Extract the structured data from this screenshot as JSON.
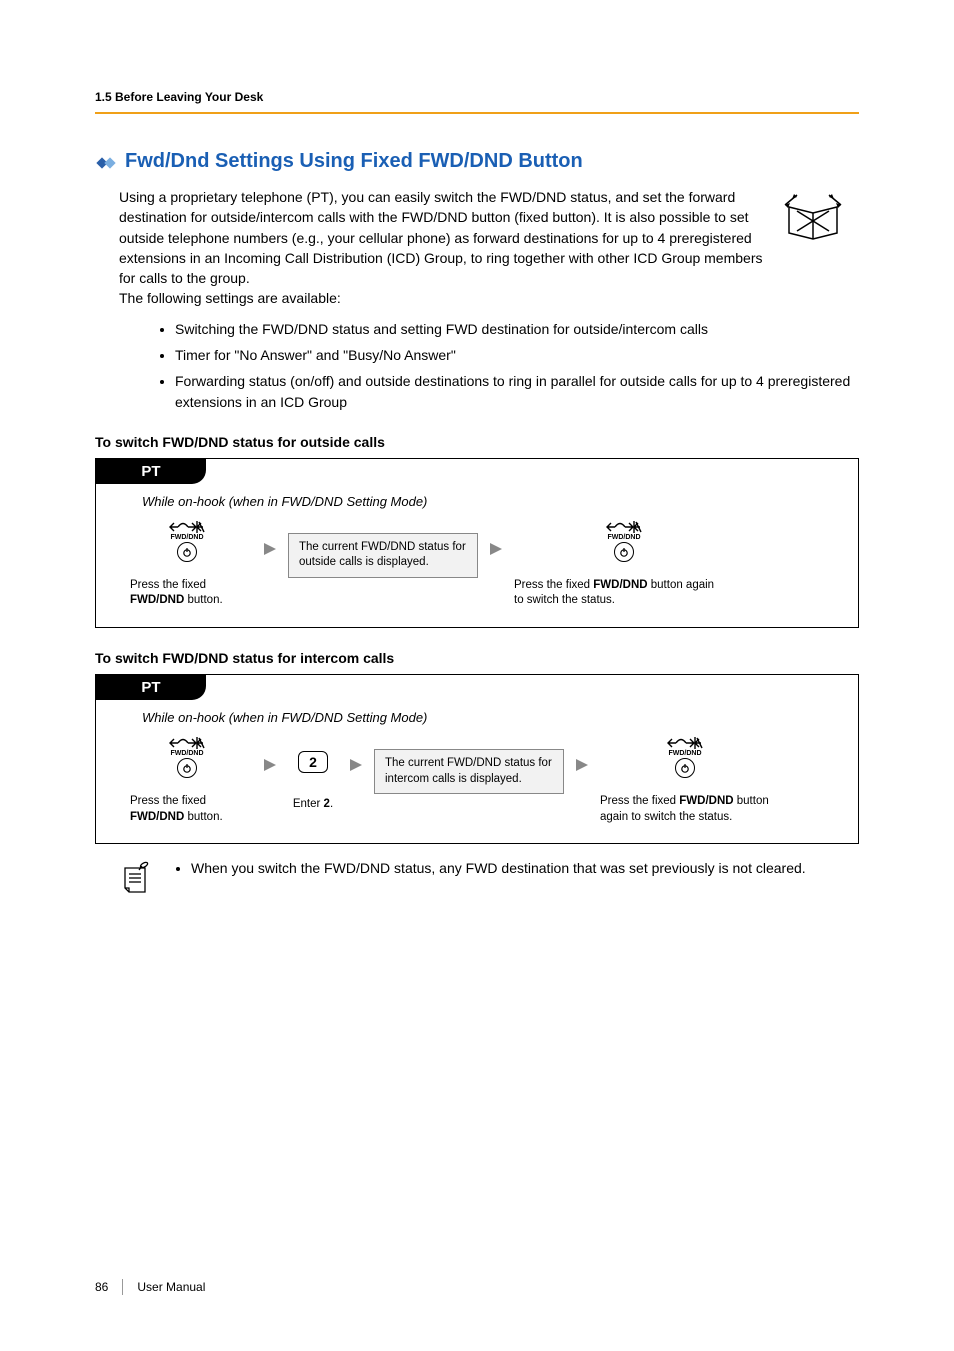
{
  "header": {
    "running": "1.5 Before Leaving Your Desk"
  },
  "section": {
    "title": "Fwd/Dnd Settings Using Fixed FWD/DND Button",
    "intro": "Using a proprietary telephone (PT), you can easily switch the FWD/DND status, and set the forward destination for outside/intercom calls with the FWD/DND button (fixed button). It is also possible to set outside telephone numbers (e.g., your cellular phone) as forward destinations for up to 4 preregistered extensions in an Incoming Call Distribution (ICD) Group, to ring together with other ICD Group members for calls to the group.\nThe following settings are available:",
    "bullets": [
      "Switching the FWD/DND status and setting FWD destination for outside/intercom calls",
      "Timer for \"No Answer\" and \"Busy/No Answer\"",
      "Forwarding status (on/off) and outside destinations to ring in parallel for outside calls for up to 4 preregistered extensions in an ICD Group"
    ]
  },
  "proc1": {
    "heading": "To switch FWD/DND status for outside calls",
    "tab": "PT",
    "condition": "While on-hook (when in FWD/DND Setting Mode)",
    "icon_label": "FWD/DND",
    "status_box": "The current FWD/DND status for outside calls is displayed.",
    "step1_text1": "Press the fixed",
    "step1_text2": "FWD/DND",
    "step1_text3": " button.",
    "step2_text1": "Press the fixed ",
    "step2_text2": "FWD/DND",
    "step2_text3": " button again to switch the status."
  },
  "proc2": {
    "heading": "To switch FWD/DND status for intercom calls",
    "tab": "PT",
    "condition": "While on-hook (when in FWD/DND Setting Mode)",
    "icon_label": "FWD/DND",
    "digit": "2",
    "status_box": "The current FWD/DND status for intercom calls is displayed.",
    "step1_text1": "Press the fixed",
    "step1_text2": "FWD/DND",
    "step1_text3": " button.",
    "enter_text1": "Enter ",
    "enter_text2": "2",
    "enter_text3": ".",
    "step2_text1": "Press the fixed ",
    "step2_text2": "FWD/DND",
    "step2_text3": " button again to switch the status."
  },
  "note": {
    "text": "When you switch the FWD/DND status, any FWD destination that was set previously is not cleared."
  },
  "footer": {
    "page": "86",
    "label": "User Manual"
  }
}
